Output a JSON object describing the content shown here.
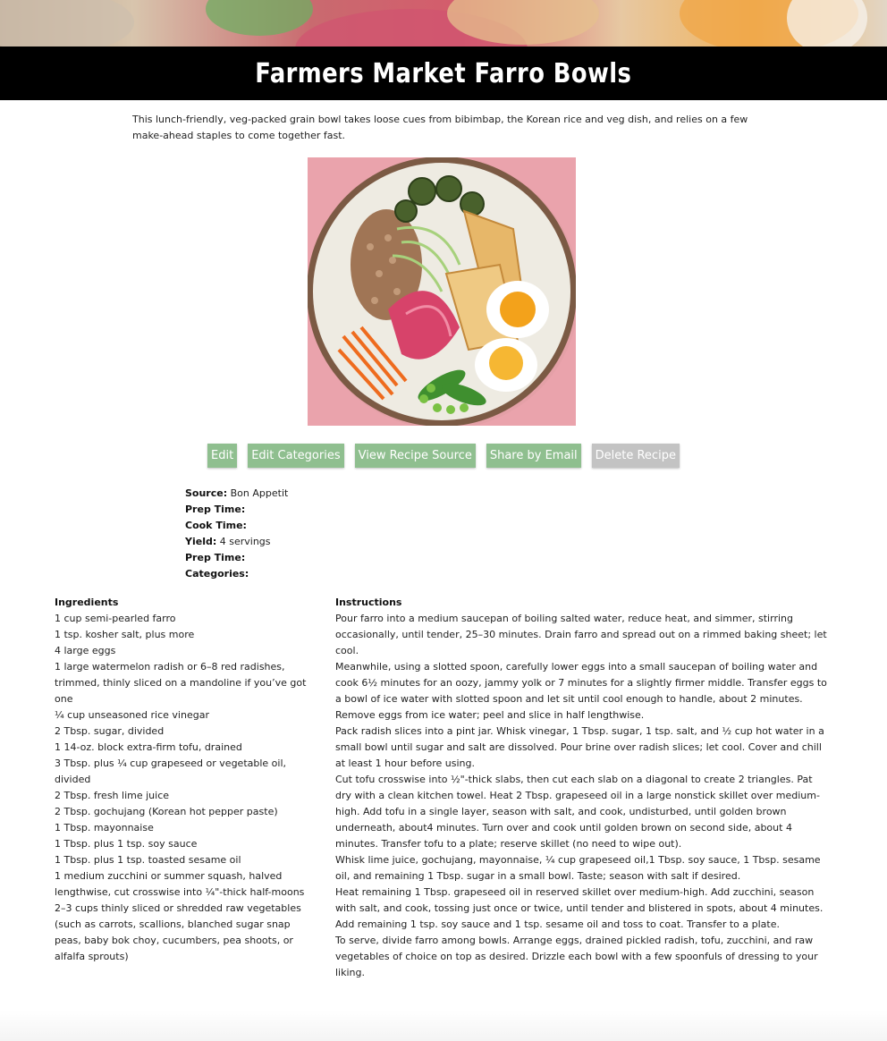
{
  "recipe": {
    "title": "Farmers Market Farro Bowls",
    "intro": "This lunch-friendly, veg-packed grain bowl takes loose cues from bibimbap, the Korean rice and veg dish, and relies on a few make-ahead staples to come together fast."
  },
  "actions": {
    "edit": "Edit",
    "edit_categories": "Edit Categories",
    "view_source": "View Recipe Source",
    "share_email": "Share by Email",
    "delete": "Delete Recipe"
  },
  "meta": {
    "source_label": "Source:",
    "source_value": "Bon Appetit",
    "prep_label": "Prep Time:",
    "prep_value": "",
    "cook_label": "Cook Time:",
    "cook_value": "",
    "yield_label": "Yield:",
    "yield_value": "4 servings",
    "prep2_label": "Prep Time:",
    "prep2_value": "",
    "categories_label": "Categories:",
    "categories_value": ""
  },
  "ingredients": {
    "heading": "Ingredients",
    "items": [
      "1 cup semi-pearled farro",
      "1 tsp. kosher salt, plus more",
      "4 large eggs",
      "1 large watermelon radish or 6–8 red radishes, trimmed, thinly sliced on a mandoline if you’ve got one",
      "¼ cup unseasoned rice vinegar",
      "2 Tbsp. sugar, divided",
      "1 14-oz. block extra-firm tofu, drained",
      "3 Tbsp. plus ¼ cup grapeseed or vegetable oil, divided",
      "2 Tbsp. fresh lime juice",
      "2 Tbsp. gochujang (Korean hot pepper paste)",
      "1 Tbsp. mayonnaise",
      "1 Tbsp. plus 1 tsp. soy sauce",
      "1 Tbsp. plus 1 tsp. toasted sesame oil",
      "1 medium zucchini or summer squash, halved lengthwise, cut crosswise into ¼\"-thick half-moons",
      "2–3 cups thinly sliced or shredded raw vegetables (such as carrots, scallions, blanched sugar snap peas, baby bok choy, cucumbers, pea shoots, or alfalfa sprouts)"
    ]
  },
  "instructions": {
    "heading": "Instructions",
    "steps": [
      "Pour farro into a medium saucepan of boiling salted water, reduce heat, and simmer, stirring occasionally, until tender, 25–30 minutes. Drain farro and spread out on a rimmed baking sheet; let cool.",
      "Meanwhile, using a slotted spoon, carefully lower eggs into a small saucepan of boiling water and cook 6½ minutes for an oozy, jammy yolk or 7 minutes for a slightly firmer middle. Transfer eggs to a bowl of ice water with slotted spoon and let sit until cool enough to handle, about 2 minutes. Remove eggs from ice water; peel and slice in half lengthwise.",
      "Pack radish slices into a pint jar. Whisk vinegar, 1 Tbsp. sugar, 1 tsp. salt, and ½ cup hot water in a small bowl until sugar and salt are dissolved. Pour brine over radish slices; let cool. Cover and chill at least 1 hour before using.",
      "Cut tofu crosswise into ½\"-thick slabs, then cut each slab on a diagonal to create 2 triangles. Pat dry with a clean kitchen towel. Heat 2 Tbsp. grapeseed oil in a large nonstick skillet over medium-high. Add tofu in a single layer, season with salt, and cook, undisturbed, until golden brown underneath, about4 minutes. Turn over and cook until golden brown on second side, about 4 minutes. Transfer tofu to a plate; reserve skillet (no need to wipe out).",
      "Whisk lime juice, gochujang, mayonnaise, ¼ cup grapeseed oil,1 Tbsp. soy sauce, 1 Tbsp. sesame oil, and remaining 1 Tbsp. sugar in a small bowl. Taste; season with salt if desired.",
      "Heat remaining 1 Tbsp. grapeseed oil in reserved skillet over medium-high. Add zucchini, season with salt, and cook, tossing just once or twice, until tender and blistered in spots, about 4 minutes. Add remaining 1 tsp. soy sauce and 1 tsp. sesame oil and toss to coat. Transfer to a plate.",
      "To serve, divide farro among bowls. Arrange eggs, drained pickled radish, tofu, zucchini, and raw vegetables of choice on top as desired. Drizzle each bowl with a few spoonfuls of dressing to your liking."
    ]
  },
  "colors": {
    "button_green": "#8fbf8f",
    "button_gray": "#c3c3c3",
    "title_bar": "#000000",
    "photo_bg": "#eaa3ac"
  }
}
